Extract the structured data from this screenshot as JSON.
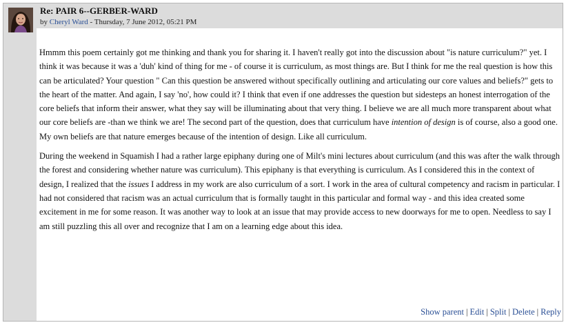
{
  "post": {
    "subject": "Re: PAIR 6--GERBER-WARD",
    "by_prefix": "by ",
    "author": "Cheryl Ward",
    "date": " - Thursday, 7 June 2012, 05:21 PM",
    "p1_a": "Hmmm this poem certainly got me thinking and thank you for sharing it. I haven't really got into the discussion about \"is nature curriculum?\" yet. I think it was because it was a 'duh' kind of thing for me - of course it is curriculum, as most things are. But I think for me the real question is how this can be articulated? Your question \" Can this question be answered without specifically outlining and articulating our core values and beliefs?\" gets to the heart of the matter. And again, I say 'no', how could it? I think that even if one addresses the question but sidesteps an honest interrogation of the core beliefs that inform their answer, what they say will be illuminating about that very thing. I believe we are all much more transparent about what our core beliefs are -than we think we are!  The second part of the question, does that curriculum have ",
    "p1_em": "intention of design",
    "p1_b": " is of  course, also a good one. My own beliefs are that nature emerges because of the intention of design. Like all curriculum.",
    "p2_a": "During the weekend in Squamish I had a rather large epiphany during one of Milt's mini lectures about curriculum (and this was after the walk through the forest and considering whether nature was curriculum). This epiphany is that everything is curriculum. As I considered this in the context of design, I realized that the ",
    "p2_em": "issues",
    "p2_b": " I address in my work are also curriculum of a sort. I work in the area of cultural competency and racism in particular. I had not considered that racism was an actual curriculum that is formally taught in this particular and formal way - and this idea created some excitement in me for some reason. It was another way to look at an issue that may provide access to new doorways for me to open. Needless to say I am still puzzling this all over and recognize that I am on a learning edge about this idea."
  },
  "commands": {
    "show_parent": "Show parent",
    "edit": "Edit",
    "split": "Split",
    "delete": "Delete",
    "reply": "Reply",
    "separator": "|"
  }
}
